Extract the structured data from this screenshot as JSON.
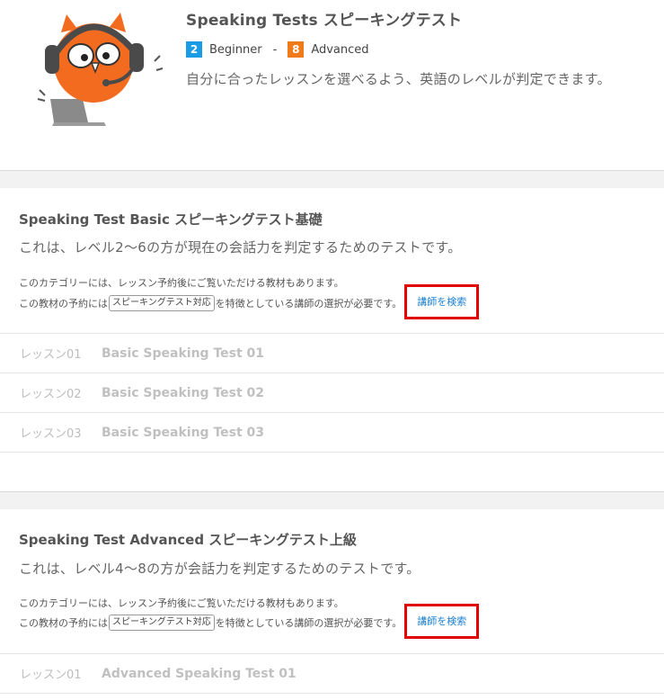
{
  "header": {
    "title": "Speaking Tests スピーキングテスト",
    "level_from_num": "2",
    "level_from_label": "Beginner",
    "dash": "-",
    "level_to_num": "8",
    "level_to_label": "Advanced",
    "description": "自分に合ったレッスンを選べるよう、英語のレベルが判定できます。"
  },
  "sections": [
    {
      "title": "Speaking Test Basic スピーキングテスト基礎",
      "subtitle": "これは、レベル2〜6の方が現在の会話力を判定するためのテストです。",
      "note1": "このカテゴリーには、レッスン予約後にご覧いただける教材もあります。",
      "note2_before": "この教材の予約には",
      "tag": "スピーキングテスト対応",
      "note2_after": "を特徴としている講師の選択が必要です。",
      "search_link": "講師を検索",
      "lessons": [
        {
          "num": "レッスン01",
          "name": "Basic Speaking Test 01"
        },
        {
          "num": "レッスン02",
          "name": "Basic Speaking Test 02"
        },
        {
          "num": "レッスン03",
          "name": "Basic Speaking Test 03"
        }
      ]
    },
    {
      "title": "Speaking Test Advanced スピーキングテスト上級",
      "subtitle": "これは、レベル4〜8の方が会話力を判定するためのテストです。",
      "note1": "このカテゴリーには、レッスン予約後にご覧いただける教材もあります。",
      "note2_before": "この教材の予約には",
      "tag": "スピーキングテスト対応",
      "note2_after": "を特徴としている講師の選択が必要です。",
      "search_link": "講師を検索",
      "lessons": [
        {
          "num": "レッスン01",
          "name": "Advanced Speaking Test 01"
        }
      ]
    }
  ],
  "colors": {
    "beginner_badge": "#1a9be6",
    "advanced_badge": "#f07b1a",
    "link": "#1a7fd0",
    "highlight_box": "#e00000"
  }
}
